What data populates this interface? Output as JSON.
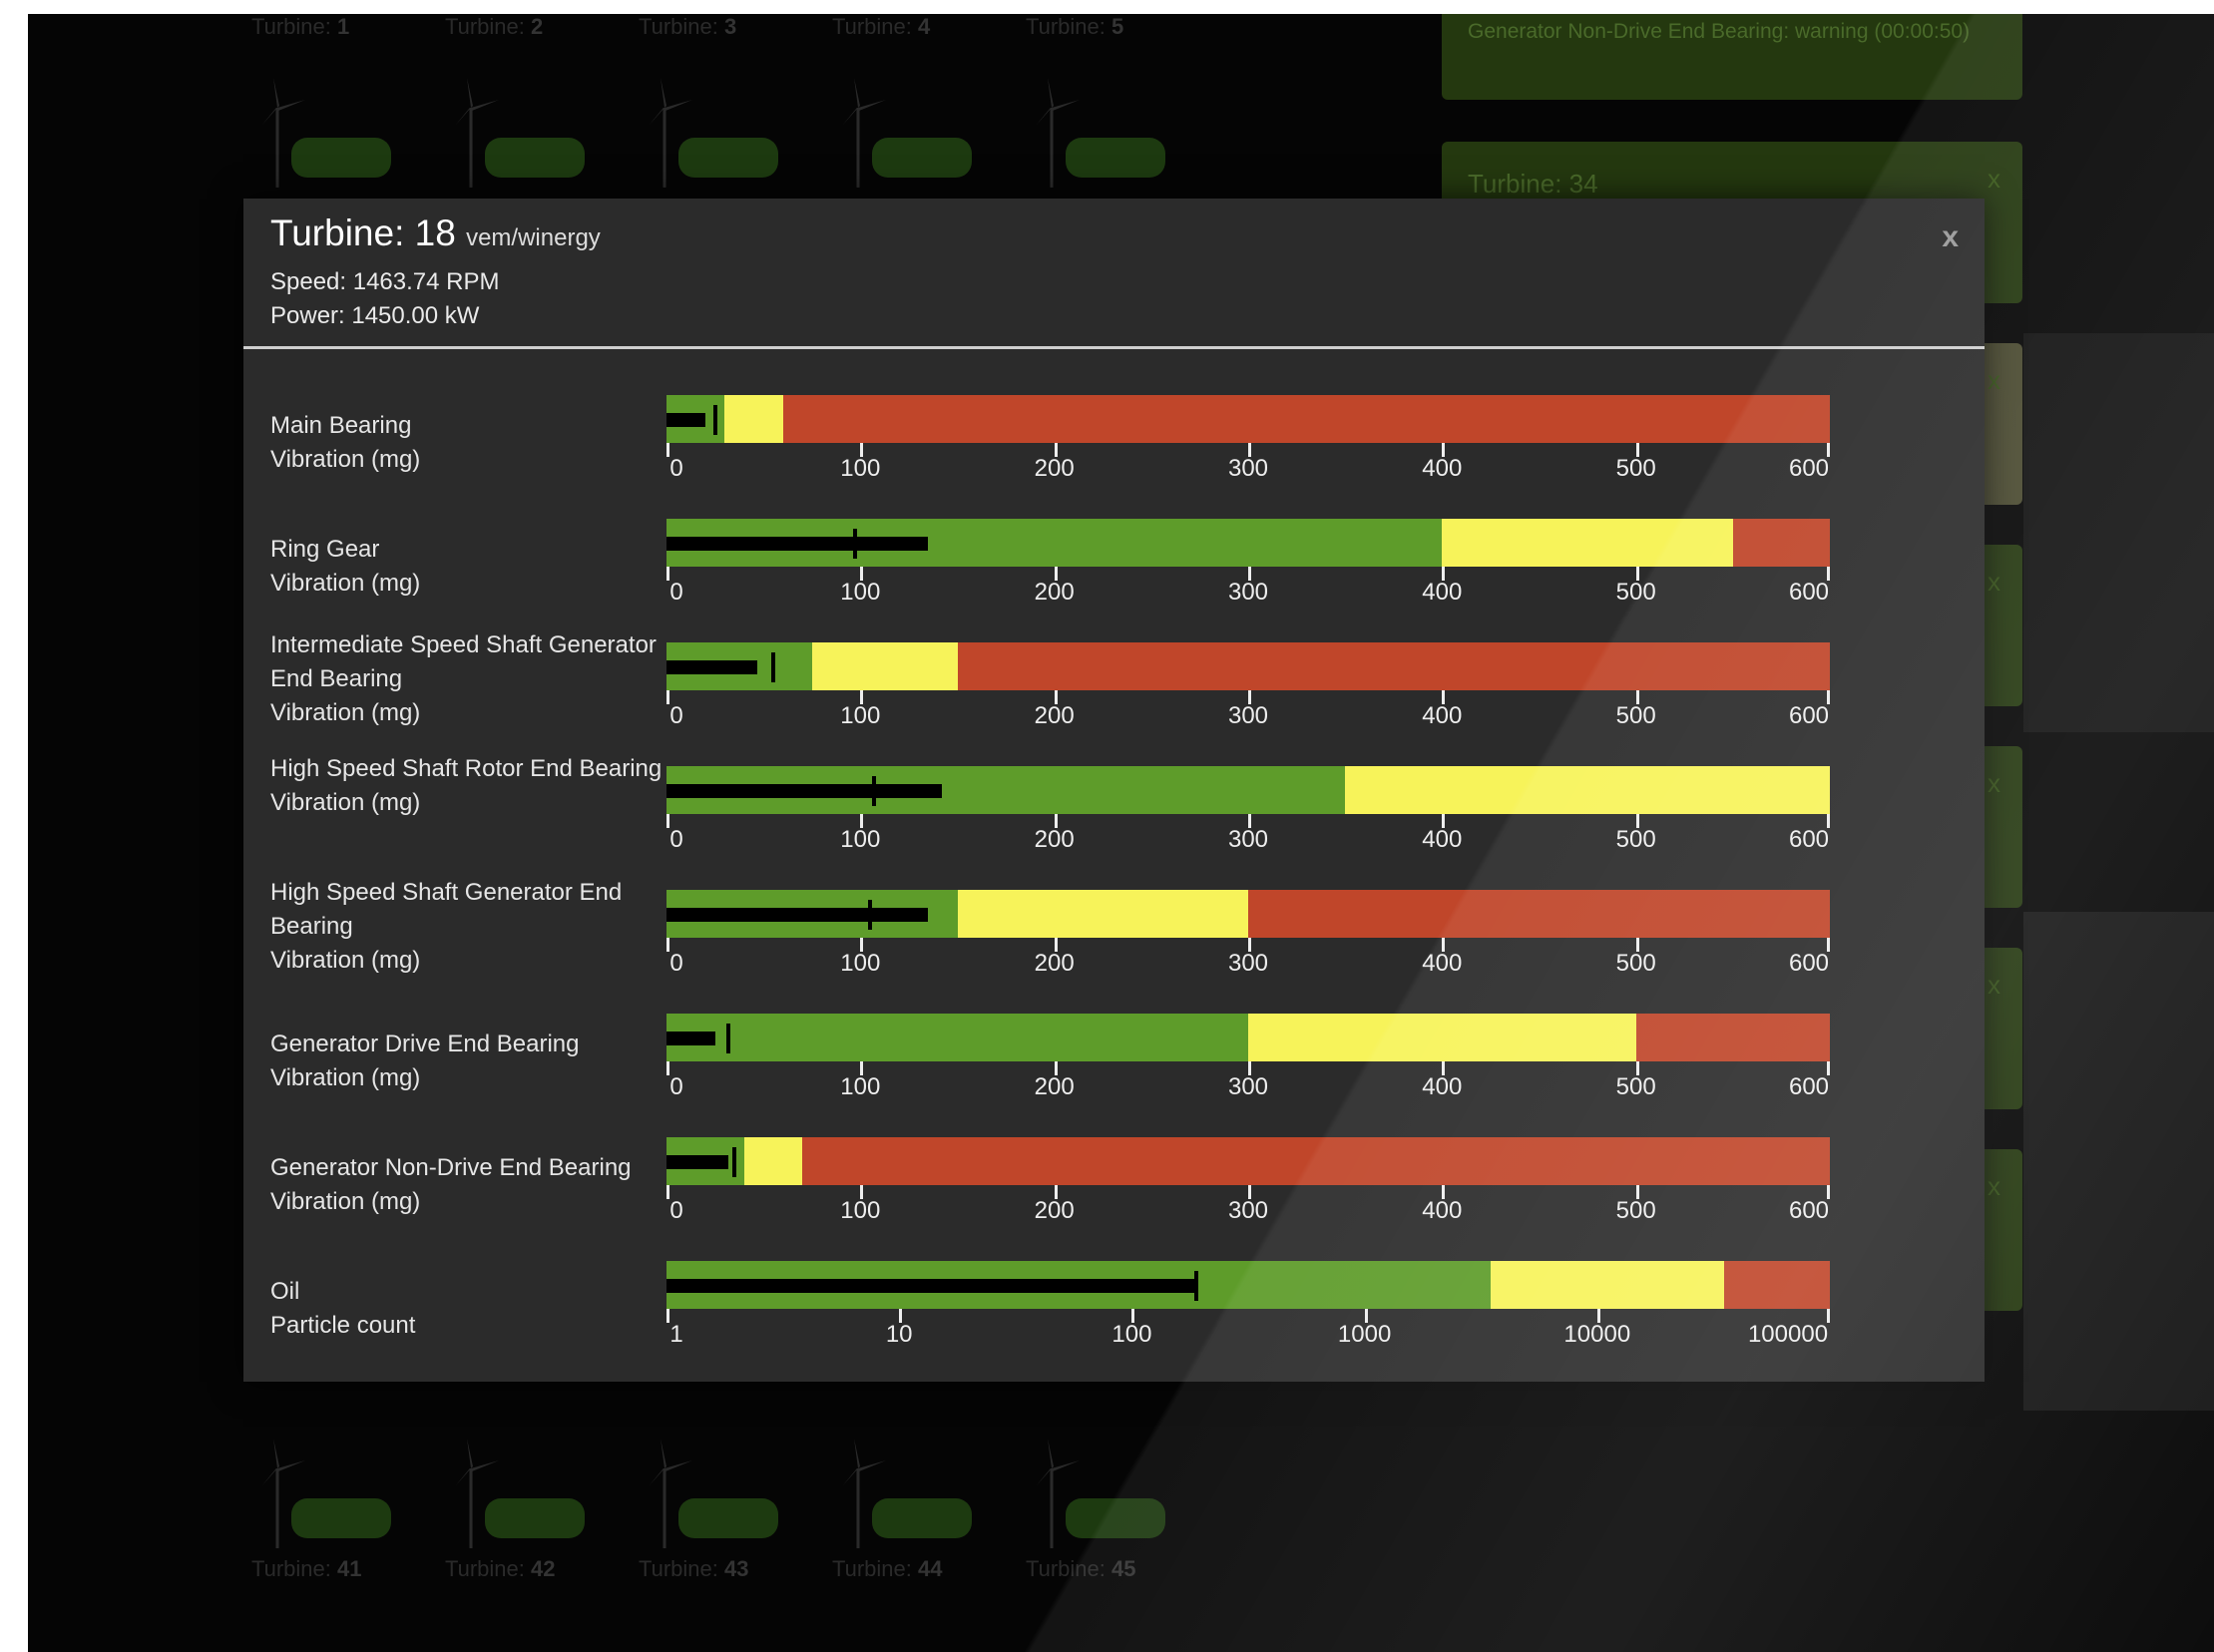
{
  "top_turbines": [
    {
      "label": "Turbine: ",
      "num": "1"
    },
    {
      "label": "Turbine: ",
      "num": "2"
    },
    {
      "label": "Turbine: ",
      "num": "3"
    },
    {
      "label": "Turbine: ",
      "num": "4"
    },
    {
      "label": "Turbine: ",
      "num": "5"
    }
  ],
  "bottom_turbines": [
    {
      "label": "Turbine: ",
      "num": "41"
    },
    {
      "label": "Turbine: ",
      "num": "42"
    },
    {
      "label": "Turbine: ",
      "num": "43"
    },
    {
      "label": "Turbine: ",
      "num": "44"
    },
    {
      "label": "Turbine: ",
      "num": "45"
    }
  ],
  "alerts": [
    {
      "text": "Generator Non-Drive End Bearing: warning (00:00:50)"
    },
    {
      "text": "Turbine: 34"
    }
  ],
  "close_glyph": "x",
  "modal": {
    "title": "Turbine: 18",
    "subtitle": "vem/winergy",
    "speed": "Speed: 1463.74 RPM",
    "power": "Power: 1450.00 kW",
    "close": "x"
  },
  "colors": {
    "green": "#5e9c2a",
    "yellow": "#f7f35a",
    "red": "#c0462a",
    "measure": "#000000"
  },
  "gauges": [
    {
      "label": "Main Bearing",
      "unit": "Vibration (mg)",
      "scale": "linear",
      "min": 0,
      "max": 600,
      "ticks": [
        "0",
        "100",
        "200",
        "300",
        "400",
        "500",
        "600"
      ],
      "ranges": [
        {
          "to": 30,
          "color": "green"
        },
        {
          "to": 60,
          "color": "yellow"
        },
        {
          "to": 600,
          "color": "red"
        }
      ],
      "value": 20,
      "target": 25
    },
    {
      "label": "Ring Gear",
      "unit": "Vibration (mg)",
      "scale": "linear",
      "min": 0,
      "max": 600,
      "ticks": [
        "0",
        "100",
        "200",
        "300",
        "400",
        "500",
        "600"
      ],
      "ranges": [
        {
          "to": 400,
          "color": "green"
        },
        {
          "to": 550,
          "color": "yellow"
        },
        {
          "to": 600,
          "color": "red"
        }
      ],
      "value": 135,
      "target": 97
    },
    {
      "label": "Intermediate Speed Shaft Generator End Bearing",
      "unit": "Vibration (mg)",
      "scale": "linear",
      "min": 0,
      "max": 600,
      "ticks": [
        "0",
        "100",
        "200",
        "300",
        "400",
        "500",
        "600"
      ],
      "ranges": [
        {
          "to": 75,
          "color": "green"
        },
        {
          "to": 150,
          "color": "yellow"
        },
        {
          "to": 600,
          "color": "red"
        }
      ],
      "value": 47,
      "target": 55
    },
    {
      "label": "High Speed Shaft Rotor End Bearing",
      "unit": "Vibration (mg)",
      "scale": "linear",
      "min": 0,
      "max": 600,
      "ticks": [
        "0",
        "100",
        "200",
        "300",
        "400",
        "500",
        "600"
      ],
      "ranges": [
        {
          "to": 350,
          "color": "green"
        },
        {
          "to": 600,
          "color": "yellow"
        }
      ],
      "value": 142,
      "target": 107
    },
    {
      "label": "High Speed Shaft Generator End Bearing",
      "unit": "Vibration (mg)",
      "scale": "linear",
      "min": 0,
      "max": 600,
      "ticks": [
        "0",
        "100",
        "200",
        "300",
        "400",
        "500",
        "600"
      ],
      "ranges": [
        {
          "to": 150,
          "color": "green"
        },
        {
          "to": 300,
          "color": "yellow"
        },
        {
          "to": 600,
          "color": "red"
        }
      ],
      "value": 135,
      "target": 105
    },
    {
      "label": "Generator Drive End Bearing",
      "unit": "Vibration (mg)",
      "scale": "linear",
      "min": 0,
      "max": 600,
      "ticks": [
        "0",
        "100",
        "200",
        "300",
        "400",
        "500",
        "600"
      ],
      "ranges": [
        {
          "to": 300,
          "color": "green"
        },
        {
          "to": 500,
          "color": "yellow"
        },
        {
          "to": 600,
          "color": "red"
        }
      ],
      "value": 25,
      "target": 32
    },
    {
      "label": "Generator Non-Drive End Bearing",
      "unit": "Vibration (mg)",
      "scale": "linear",
      "min": 0,
      "max": 600,
      "ticks": [
        "0",
        "100",
        "200",
        "300",
        "400",
        "500",
        "600"
      ],
      "ranges": [
        {
          "to": 40,
          "color": "green"
        },
        {
          "to": 70,
          "color": "yellow"
        },
        {
          "to": 600,
          "color": "red"
        }
      ],
      "value": 32,
      "target": 35
    },
    {
      "label": "Oil",
      "unit": "Particle count",
      "scale": "log",
      "min": 1,
      "max": 100000,
      "ticks": [
        "1",
        "10",
        "100",
        "1000",
        "10000",
        "100000"
      ],
      "ranges": [
        {
          "to": 3500,
          "color": "green"
        },
        {
          "to": 35000,
          "color": "yellow"
        },
        {
          "to": 100000,
          "color": "red"
        }
      ],
      "value": 190,
      "target": 190
    }
  ]
}
